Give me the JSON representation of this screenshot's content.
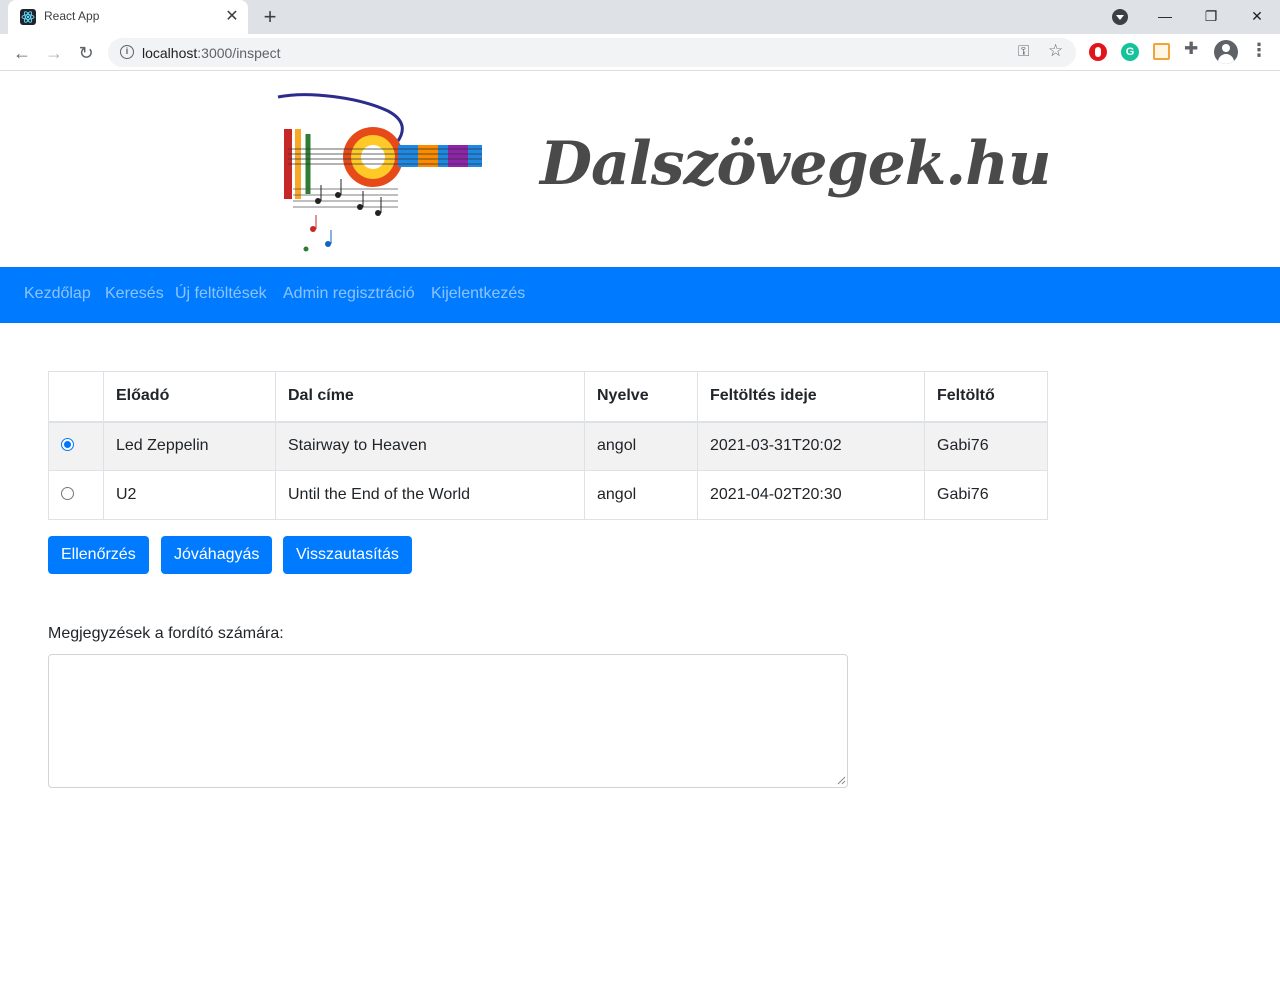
{
  "browser": {
    "tab_title": "React App",
    "tab_close": "✕",
    "new_tab": "+",
    "url_host": "localhost",
    "url_path": ":3000/inspect",
    "window": {
      "minimize": "—",
      "restore": "❐",
      "close": "✕"
    },
    "nav": {
      "back": "←",
      "forward": "→",
      "reload": "↻"
    },
    "icons": [
      "info-icon",
      "key-icon",
      "star-icon",
      "adblock-icon",
      "grammarly-icon",
      "extension-icon",
      "puzzle-icon",
      "profile-icon",
      "menu-icon"
    ]
  },
  "header": {
    "brand": "Dalszövegek.hu",
    "logo": "guitar-music-notes-logo"
  },
  "navbar": {
    "links": [
      "Kezdőlap",
      "Keresés",
      "Új feltöltések",
      "Admin regisztráció",
      "Kijelentkezés"
    ],
    "color": "#007bff"
  },
  "table": {
    "headers": [
      "",
      "Előadó",
      "Dal címe",
      "Nyelve",
      "Feltöltés ideje",
      "Feltöltő"
    ],
    "rows": [
      {
        "selected": true,
        "artist": "Led Zeppelin",
        "title": "Stairway to Heaven",
        "language": "angol",
        "uploaded_at": "2021-03-31T20:02",
        "uploader": "Gabi76"
      },
      {
        "selected": false,
        "artist": "U2",
        "title": "Until the End of the World",
        "language": "angol",
        "uploaded_at": "2021-04-02T20:30",
        "uploader": "Gabi76"
      }
    ]
  },
  "actions": {
    "check": "Ellenőrzés",
    "approve": "Jóváhagyás",
    "reject": "Visszautasítás"
  },
  "notes": {
    "label": "Megjegyzések a fordító számára:",
    "value": ""
  }
}
